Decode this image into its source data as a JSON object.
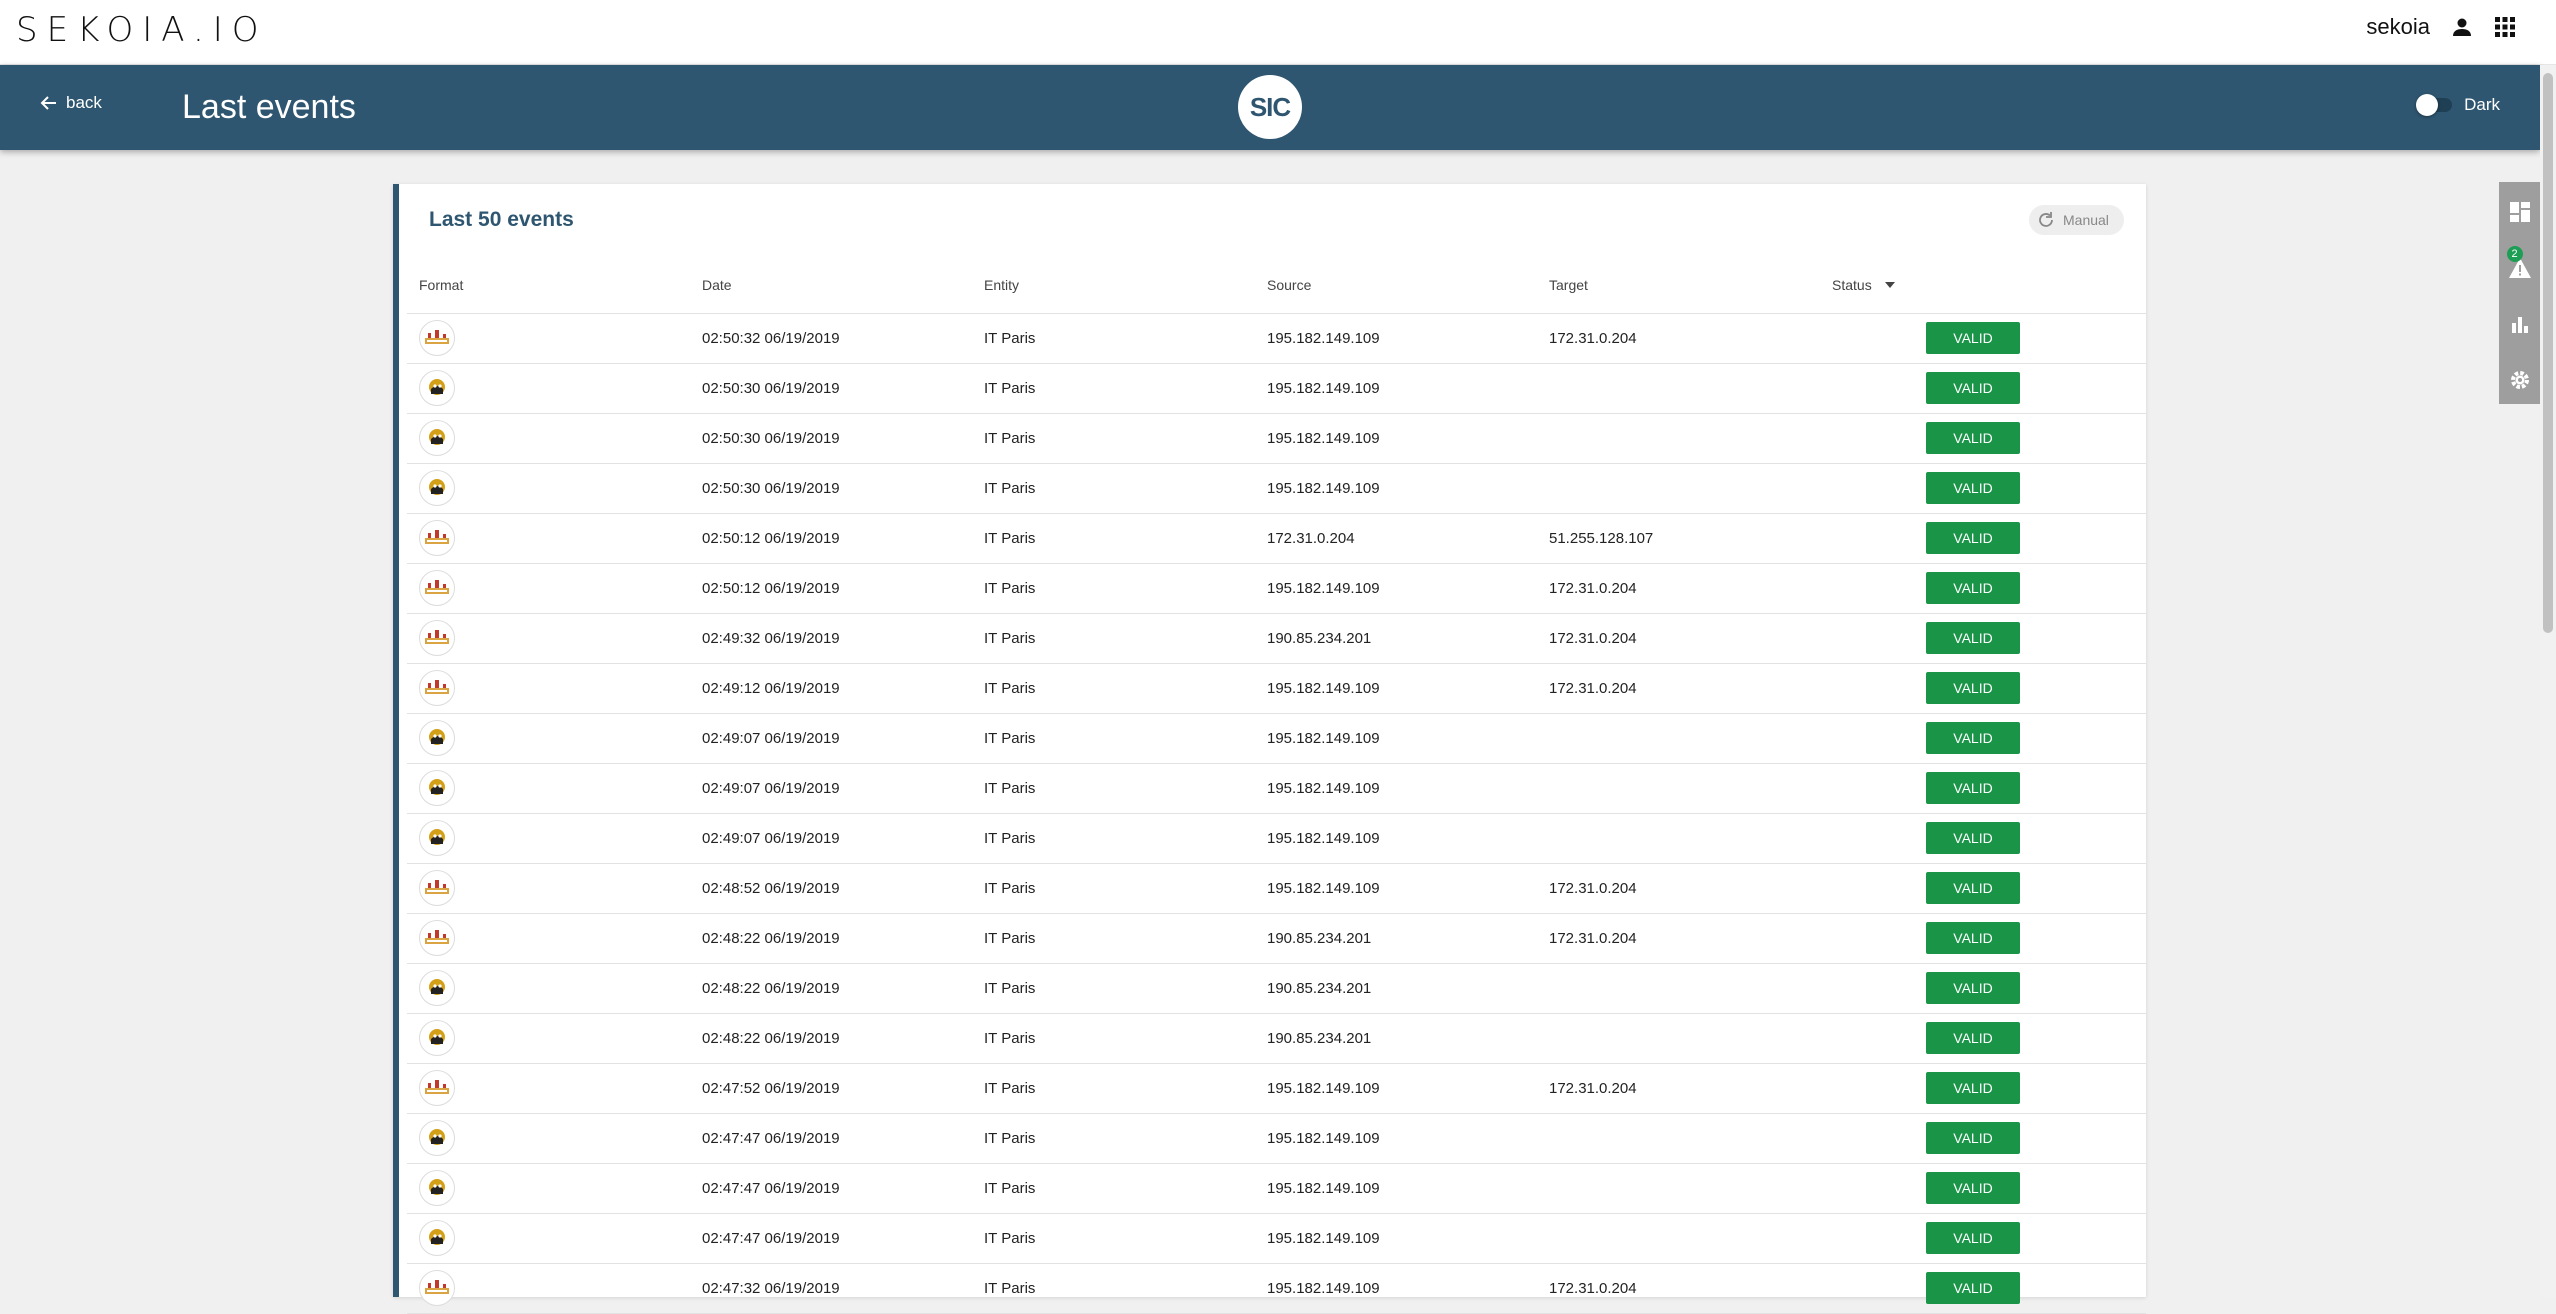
{
  "topbar": {
    "logo": "SEKOIA.IO",
    "username": "sekoia",
    "user_icon": "user-icon",
    "apps_icon": "apps-grid-icon"
  },
  "header": {
    "back_label": "back",
    "title": "Last events",
    "logo_text": "SIC",
    "theme_label": "Dark"
  },
  "sidebar": {
    "alert_badge": "2",
    "icons": [
      "dashboard-icon",
      "alert-icon",
      "chart-icon",
      "settings-icon"
    ]
  },
  "card": {
    "title": "Last 50 events",
    "refresh_label": "Manual",
    "columns": [
      "Format",
      "Date",
      "Entity",
      "Source",
      "Target",
      "Status"
    ],
    "rows": [
      {
        "format": "nginx",
        "date": "02:50:32 06/19/2019",
        "entity": "IT Paris",
        "source": "195.182.149.109",
        "target": "172.31.0.204",
        "status": "VALID"
      },
      {
        "format": "bot",
        "date": "02:50:30 06/19/2019",
        "entity": "IT Paris",
        "source": "195.182.149.109",
        "target": "",
        "status": "VALID"
      },
      {
        "format": "bot",
        "date": "02:50:30 06/19/2019",
        "entity": "IT Paris",
        "source": "195.182.149.109",
        "target": "",
        "status": "VALID"
      },
      {
        "format": "bot",
        "date": "02:50:30 06/19/2019",
        "entity": "IT Paris",
        "source": "195.182.149.109",
        "target": "",
        "status": "VALID"
      },
      {
        "format": "nginx",
        "date": "02:50:12 06/19/2019",
        "entity": "IT Paris",
        "source": "172.31.0.204",
        "target": "51.255.128.107",
        "status": "VALID"
      },
      {
        "format": "nginx",
        "date": "02:50:12 06/19/2019",
        "entity": "IT Paris",
        "source": "195.182.149.109",
        "target": "172.31.0.204",
        "status": "VALID"
      },
      {
        "format": "nginx",
        "date": "02:49:32 06/19/2019",
        "entity": "IT Paris",
        "source": "190.85.234.201",
        "target": "172.31.0.204",
        "status": "VALID"
      },
      {
        "format": "nginx",
        "date": "02:49:12 06/19/2019",
        "entity": "IT Paris",
        "source": "195.182.149.109",
        "target": "172.31.0.204",
        "status": "VALID"
      },
      {
        "format": "bot",
        "date": "02:49:07 06/19/2019",
        "entity": "IT Paris",
        "source": "195.182.149.109",
        "target": "",
        "status": "VALID"
      },
      {
        "format": "bot",
        "date": "02:49:07 06/19/2019",
        "entity": "IT Paris",
        "source": "195.182.149.109",
        "target": "",
        "status": "VALID"
      },
      {
        "format": "bot",
        "date": "02:49:07 06/19/2019",
        "entity": "IT Paris",
        "source": "195.182.149.109",
        "target": "",
        "status": "VALID"
      },
      {
        "format": "nginx",
        "date": "02:48:52 06/19/2019",
        "entity": "IT Paris",
        "source": "195.182.149.109",
        "target": "172.31.0.204",
        "status": "VALID"
      },
      {
        "format": "nginx",
        "date": "02:48:22 06/19/2019",
        "entity": "IT Paris",
        "source": "190.85.234.201",
        "target": "172.31.0.204",
        "status": "VALID"
      },
      {
        "format": "bot",
        "date": "02:48:22 06/19/2019",
        "entity": "IT Paris",
        "source": "190.85.234.201",
        "target": "",
        "status": "VALID"
      },
      {
        "format": "bot",
        "date": "02:48:22 06/19/2019",
        "entity": "IT Paris",
        "source": "190.85.234.201",
        "target": "",
        "status": "VALID"
      },
      {
        "format": "nginx",
        "date": "02:47:52 06/19/2019",
        "entity": "IT Paris",
        "source": "195.182.149.109",
        "target": "172.31.0.204",
        "status": "VALID"
      },
      {
        "format": "bot",
        "date": "02:47:47 06/19/2019",
        "entity": "IT Paris",
        "source": "195.182.149.109",
        "target": "",
        "status": "VALID"
      },
      {
        "format": "bot",
        "date": "02:47:47 06/19/2019",
        "entity": "IT Paris",
        "source": "195.182.149.109",
        "target": "",
        "status": "VALID"
      },
      {
        "format": "bot",
        "date": "02:47:47 06/19/2019",
        "entity": "IT Paris",
        "source": "195.182.149.109",
        "target": "",
        "status": "VALID"
      },
      {
        "format": "nginx",
        "date": "02:47:32 06/19/2019",
        "entity": "IT Paris",
        "source": "195.182.149.109",
        "target": "172.31.0.204",
        "status": "VALID"
      }
    ]
  },
  "colors": {
    "header": "#2f5670",
    "valid": "#1a9548",
    "badge": "#1e9e55"
  }
}
